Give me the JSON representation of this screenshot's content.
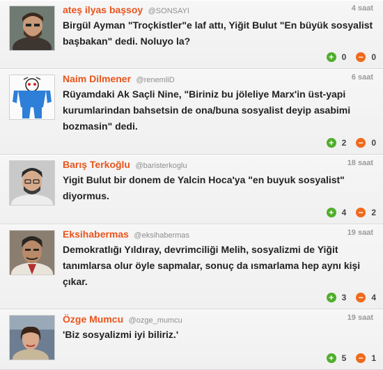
{
  "tweets": [
    {
      "name": "ateş ilyas başsoy",
      "handle": "@SONSAYI",
      "time": "4 saat",
      "text": "Birgül Ayman \"Troçkistler\"e laf attı, Yiğit Bulut \"En büyük sosyalist başbakan\" dedi. Noluyo la?",
      "up": "0",
      "down": "0"
    },
    {
      "name": "Naim Dilmener",
      "handle": "@renemliD",
      "time": "6 saat",
      "text": "Rüyamdaki Ak Saçli Nine, \"Biriniz bu jöleliye Marx'in üst-yapi kurumlarindan bahsetsin de ona/buna sosyalist deyip asabimi bozmasin\" dedi.",
      "up": "2",
      "down": "0"
    },
    {
      "name": "Barış Terkoğlu",
      "handle": "@baristerkoglu",
      "time": "18 saat",
      "text": "Yigit Bulut bir donem de Yalcin Hoca'ya \"en buyuk sosyalist\" diyormus.",
      "up": "4",
      "down": "2"
    },
    {
      "name": "Eksihabermas",
      "handle": "@eksihabermas",
      "time": "19 saat",
      "text": "Demokratlığı Yıldıray, devrimciliği Melih, sosyalizmi de Yiğit tanımlarsa olur öyle sapmalar, sonuç da ısmarlama hep aynı kişi çıkar.",
      "up": "3",
      "down": "4"
    },
    {
      "name": "Özge Mumcu",
      "handle": "@ozge_mumcu",
      "time": "19 saat",
      "text": "'Biz sosyalizmi iyi biliriz.'",
      "up": "5",
      "down": "1"
    }
  ],
  "icons": {
    "upvote": "plus-circle-icon",
    "downvote": "minus-circle-icon"
  },
  "colors": {
    "name": "#e8541c",
    "upvote": "#4fae2b",
    "downvote": "#f06a1c"
  }
}
